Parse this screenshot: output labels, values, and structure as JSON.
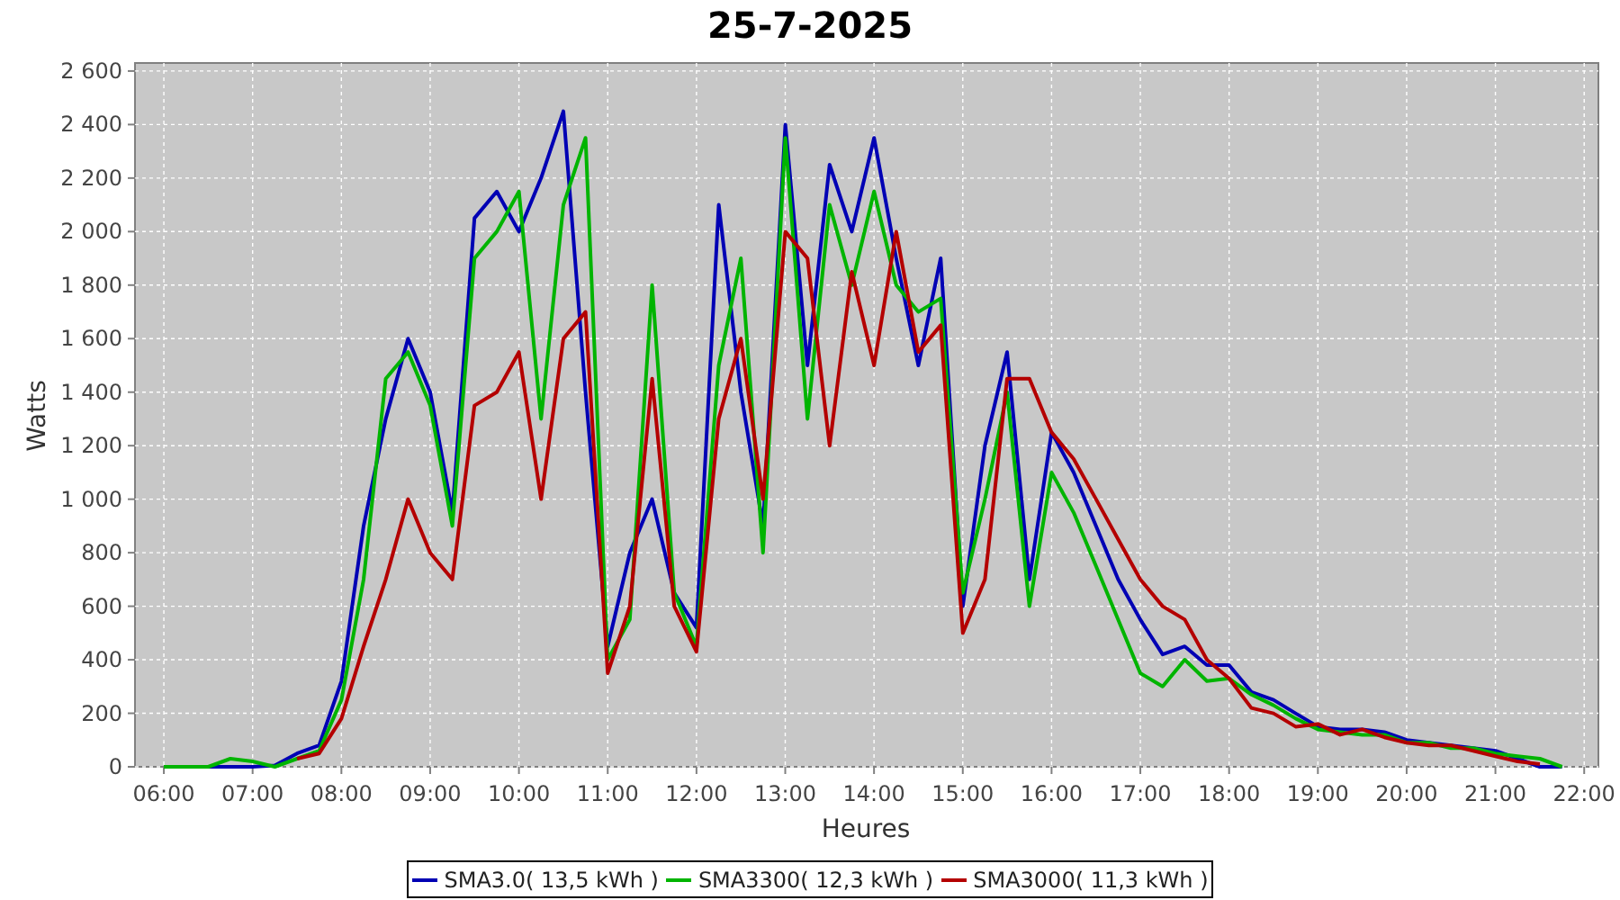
{
  "chart_data": {
    "type": "line",
    "title": "25-7-2025",
    "xlabel": "Heures",
    "ylabel": "Watts",
    "x": [
      6,
      6.25,
      6.5,
      6.75,
      7,
      7.25,
      7.5,
      7.75,
      8,
      8.25,
      8.5,
      8.75,
      9,
      9.25,
      9.5,
      9.75,
      10,
      10.25,
      10.5,
      10.75,
      11,
      11.25,
      11.5,
      11.75,
      12,
      12.25,
      12.5,
      12.75,
      13,
      13.25,
      13.5,
      13.75,
      14,
      14.25,
      14.5,
      14.75,
      15,
      15.25,
      15.5,
      15.75,
      16,
      16.25,
      16.5,
      16.75,
      17,
      17.25,
      17.5,
      17.75,
      18,
      18.25,
      18.5,
      18.75,
      19,
      19.25,
      19.5,
      19.75,
      20,
      20.25,
      20.5,
      20.75,
      21,
      21.25,
      21.5,
      21.75
    ],
    "series": [
      {
        "name": "SMA3.0( 13,5 kWh )",
        "color": "#0000b4",
        "values": [
          0,
          0,
          0,
          0,
          0,
          5,
          50,
          80,
          320,
          900,
          1300,
          1600,
          1400,
          950,
          2050,
          2150,
          2000,
          2200,
          2450,
          1400,
          450,
          800,
          1000,
          650,
          520,
          2100,
          1400,
          900,
          2400,
          1500,
          2250,
          2000,
          2350,
          1900,
          1500,
          1900,
          600,
          1200,
          1550,
          700,
          1250,
          1100,
          900,
          700,
          550,
          420,
          450,
          380,
          380,
          280,
          250,
          200,
          150,
          140,
          140,
          130,
          100,
          90,
          80,
          70,
          60,
          30,
          0,
          0
        ]
      },
      {
        "name": "SMA3300( 12,3 kWh )",
        "color": "#00b400",
        "values": [
          0,
          0,
          0,
          30,
          20,
          0,
          30,
          60,
          250,
          700,
          1450,
          1550,
          1350,
          900,
          1900,
          2000,
          2150,
          1300,
          2100,
          2350,
          400,
          550,
          1800,
          650,
          450,
          1500,
          1900,
          800,
          2350,
          1300,
          2100,
          1800,
          2150,
          1800,
          1700,
          1750,
          650,
          1000,
          1400,
          600,
          1100,
          950,
          750,
          550,
          350,
          300,
          400,
          320,
          330,
          270,
          230,
          180,
          140,
          130,
          120,
          120,
          90,
          90,
          70,
          70,
          50,
          40,
          30,
          0
        ]
      },
      {
        "name": "SMA3000( 11,3 kWh )",
        "color": "#b40000",
        "values": [
          null,
          null,
          null,
          null,
          null,
          null,
          30,
          50,
          180,
          450,
          700,
          1000,
          800,
          700,
          1350,
          1400,
          1550,
          1000,
          1600,
          1700,
          350,
          600,
          1450,
          600,
          430,
          1300,
          1600,
          1000,
          2000,
          1900,
          1200,
          1850,
          1500,
          2000,
          1550,
          1650,
          500,
          700,
          1450,
          1450,
          1250,
          1150,
          1000,
          850,
          700,
          600,
          550,
          400,
          330,
          220,
          200,
          150,
          160,
          120,
          140,
          110,
          90,
          80,
          80,
          60,
          40,
          20,
          10,
          null
        ]
      }
    ],
    "xlim": [
      5.675,
      22.16
    ],
    "ylim": [
      0,
      2630
    ],
    "grid": true,
    "legend": true,
    "xticks": [
      {
        "value": 6,
        "label": "06:00"
      },
      {
        "value": 7,
        "label": "07:00"
      },
      {
        "value": 8,
        "label": "08:00"
      },
      {
        "value": 9,
        "label": "09:00"
      },
      {
        "value": 10,
        "label": "10:00"
      },
      {
        "value": 11,
        "label": "11:00"
      },
      {
        "value": 12,
        "label": "12:00"
      },
      {
        "value": 13,
        "label": "13:00"
      },
      {
        "value": 14,
        "label": "14:00"
      },
      {
        "value": 15,
        "label": "15:00"
      },
      {
        "value": 16,
        "label": "16:00"
      },
      {
        "value": 17,
        "label": "17:00"
      },
      {
        "value": 18,
        "label": "18:00"
      },
      {
        "value": 19,
        "label": "19:00"
      },
      {
        "value": 20,
        "label": "20:00"
      },
      {
        "value": 21,
        "label": "21:00"
      },
      {
        "value": 22,
        "label": "22:00"
      }
    ],
    "yticks": [
      {
        "value": 0,
        "label": "0"
      },
      {
        "value": 200,
        "label": "200"
      },
      {
        "value": 400,
        "label": "400"
      },
      {
        "value": 600,
        "label": "600"
      },
      {
        "value": 800,
        "label": "800"
      },
      {
        "value": 1000,
        "label": "1 000"
      },
      {
        "value": 1200,
        "label": "1 200"
      },
      {
        "value": 1400,
        "label": "1 400"
      },
      {
        "value": 1600,
        "label": "1 600"
      },
      {
        "value": 1800,
        "label": "1 800"
      },
      {
        "value": 2000,
        "label": "2 000"
      },
      {
        "value": 2200,
        "label": "2 200"
      },
      {
        "value": 2400,
        "label": "2 400"
      },
      {
        "value": 2600,
        "label": "2 600"
      }
    ]
  }
}
